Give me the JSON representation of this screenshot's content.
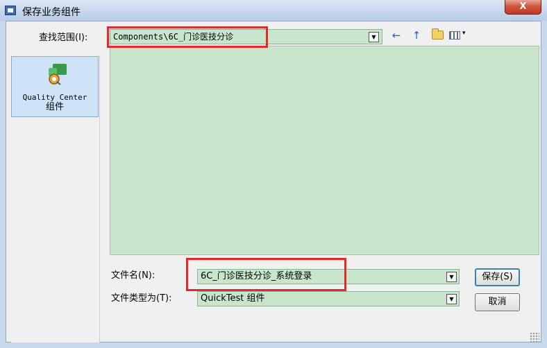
{
  "window": {
    "title": "保存业务组件",
    "close_glyph": "X"
  },
  "toolbar": {
    "lookin_label": "查找范围(I):",
    "lookin_value": "Components\\6C_门诊医技分诊",
    "back_icon": "←",
    "up_icon": "↑",
    "view_arrow": "▾"
  },
  "places": {
    "items": [
      {
        "label_line1": "Quality Center",
        "label_line2": "组件"
      }
    ]
  },
  "form": {
    "filename_label": "文件名(N):",
    "filename_value": "6C_门诊医技分诊_系统登录",
    "filetype_label": "文件类型为(T):",
    "filetype_value": "QuickTest 组件",
    "dropdown_arrow": "▼"
  },
  "buttons": {
    "save": "保存(S)",
    "cancel": "取消"
  },
  "colors": {
    "list_background": "#c9e6cd",
    "highlight_border": "#e22a2a",
    "selected_place": "#cfe3f6"
  }
}
